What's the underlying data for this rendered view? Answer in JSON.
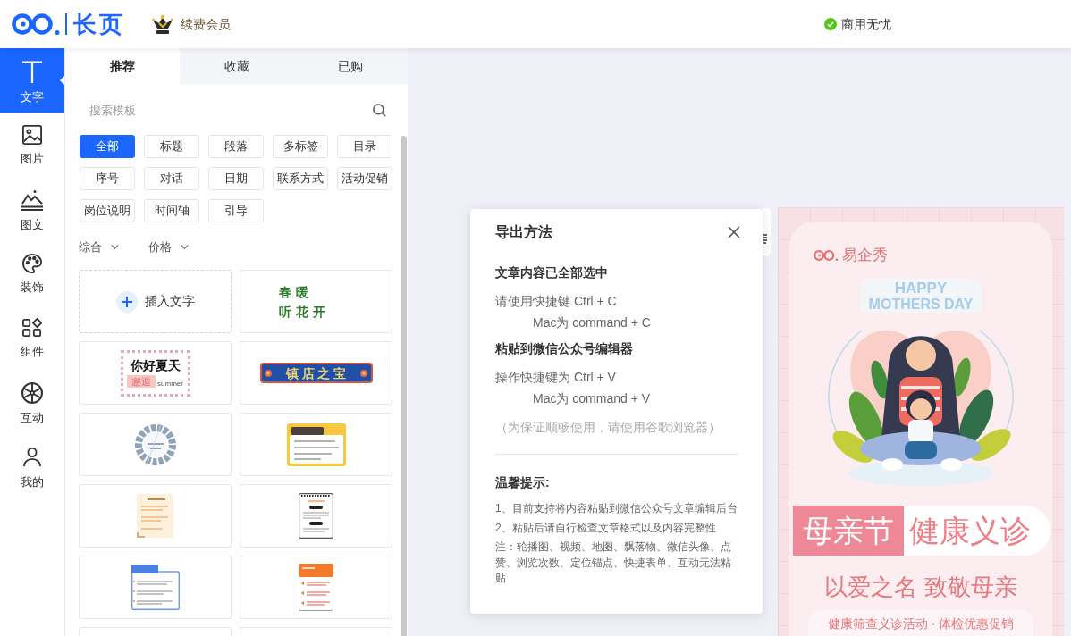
{
  "header": {
    "logo_text": "长页",
    "member_link": "续费会员",
    "commercial_badge": "商用无忧"
  },
  "sidebar": {
    "items": [
      {
        "label": "文字",
        "selected": true
      },
      {
        "label": "图片",
        "selected": false
      },
      {
        "label": "图文",
        "selected": false
      },
      {
        "label": "装饰",
        "selected": false
      },
      {
        "label": "组件",
        "selected": false
      },
      {
        "label": "互动",
        "selected": false
      },
      {
        "label": "我的",
        "selected": false
      }
    ]
  },
  "panel": {
    "tabs": [
      {
        "label": "推荐",
        "selected": true
      },
      {
        "label": "收藏",
        "selected": false
      },
      {
        "label": "已购",
        "selected": false
      }
    ],
    "search": {
      "placeholder": "搜索模板"
    },
    "filters": [
      {
        "label": "全部",
        "selected": true
      },
      {
        "label": "标题",
        "selected": false
      },
      {
        "label": "段落",
        "selected": false
      },
      {
        "label": "多标签",
        "selected": false
      },
      {
        "label": "目录",
        "selected": false
      },
      {
        "label": "序号",
        "selected": false
      },
      {
        "label": "对话",
        "selected": false
      },
      {
        "label": "日期",
        "selected": false
      },
      {
        "label": "联系方式",
        "selected": false
      },
      {
        "label": "活动促销",
        "selected": false
      },
      {
        "label": "岗位说明",
        "selected": false
      },
      {
        "label": "时间轴",
        "selected": false
      },
      {
        "label": "引导",
        "selected": false
      }
    ],
    "sort_menus": [
      "综合",
      "价格"
    ],
    "templates": [
      {
        "kind": "insert",
        "label": "插入文字"
      },
      {
        "kind": "spring",
        "lines": [
          "春 暖",
          "听 花 开"
        ]
      },
      {
        "kind": "summer",
        "lines": [
          "你好夏天",
          "邂逅",
          "summer"
        ]
      },
      {
        "kind": "banner",
        "lines": [
          "镇 店 之 宝"
        ]
      },
      {
        "kind": "wreath"
      },
      {
        "kind": "infocard"
      },
      {
        "kind": "note"
      },
      {
        "kind": "notebook"
      },
      {
        "kind": "tabbed"
      },
      {
        "kind": "list"
      },
      {
        "kind": "clipped"
      },
      {
        "kind": "clipped"
      }
    ]
  },
  "dialog": {
    "title": "导出方法",
    "steps": [
      {
        "heading": "文章内容已全部选中",
        "shortcut": "请使用快捷键 Ctrl + C",
        "mac": "Mac为 command + C"
      },
      {
        "heading": "粘贴到微信公众号编辑器",
        "shortcut": "操作快捷键为 Ctrl + V",
        "mac": "Mac为 command + V"
      }
    ],
    "note": "（为保证顺畅使用，请使用谷歌浏览器）",
    "tips": {
      "heading": "温馨提示:",
      "items": [
        "1、目前支持将内容粘贴到微信公众号文章编辑后台",
        "2、粘贴后请自行检查文章格式以及内容完整性",
        "注：轮播图、视频、地图、飘落物、微信头像、点赞、浏览次数、定位锚点、快捷表单、互动无法粘贴"
      ]
    }
  },
  "poster": {
    "logo": "易企秀",
    "caption": [
      "HAPPY",
      "MOTHERS DAY"
    ],
    "title": "母亲节",
    "title_highlight": "健康义诊",
    "slogan": "以爱之名 致敬母亲",
    "subtitle": "健康筛查义诊活动 · 体检优惠促销"
  }
}
